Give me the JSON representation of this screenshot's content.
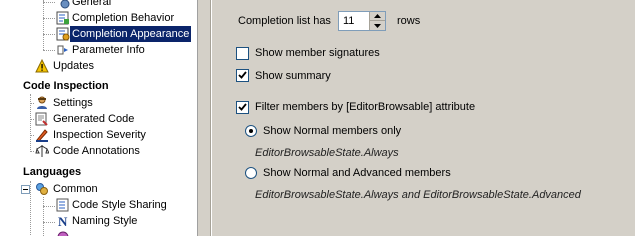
{
  "tree": {
    "items": [
      {
        "label": "General",
        "icon": "key-gear-icon"
      },
      {
        "label": "Completion Behavior",
        "icon": "completion-behavior-icon"
      },
      {
        "label": "Completion Appearance",
        "icon": "completion-appearance-icon",
        "selected": true
      },
      {
        "label": "Parameter Info",
        "icon": "parameter-info-icon"
      },
      {
        "label": "Updates",
        "icon": "warning-icon"
      }
    ],
    "code_inspection": {
      "title": "Code Inspection",
      "items": [
        {
          "label": "Settings",
          "icon": "inspector-icon"
        },
        {
          "label": "Generated Code",
          "icon": "generated-code-icon"
        },
        {
          "label": "Inspection Severity",
          "icon": "severity-icon"
        },
        {
          "label": "Code Annotations",
          "icon": "annotations-icon"
        }
      ]
    },
    "languages": {
      "title": "Languages",
      "items": [
        {
          "label": "Common",
          "icon": "common-icon"
        },
        {
          "label": "Code Style Sharing",
          "icon": "code-style-sharing-icon"
        },
        {
          "label": "Naming Style",
          "icon": "naming-style-icon"
        }
      ]
    }
  },
  "options": {
    "completion_list_label": "Completion list has",
    "completion_list_rows": "11",
    "rows_label": "rows",
    "show_member_signatures": {
      "label": "Show member signatures",
      "checked": false
    },
    "show_summary": {
      "label": "Show summary",
      "checked": true
    },
    "filter_members": {
      "label": "Filter members by [EditorBrowsable] attribute",
      "checked": true
    },
    "radio_normal": {
      "label": "Show Normal members only",
      "selected": true,
      "description": "EditorBrowsableState.Always"
    },
    "radio_advanced": {
      "label": "Show Normal and Advanced members",
      "selected": false,
      "description": "EditorBrowsableState.Always and EditorBrowsableState.Advanced"
    }
  },
  "colors": {
    "selection": "#0a246a",
    "panel_bg": "#d4d0c8",
    "warning": "#f5c400"
  }
}
